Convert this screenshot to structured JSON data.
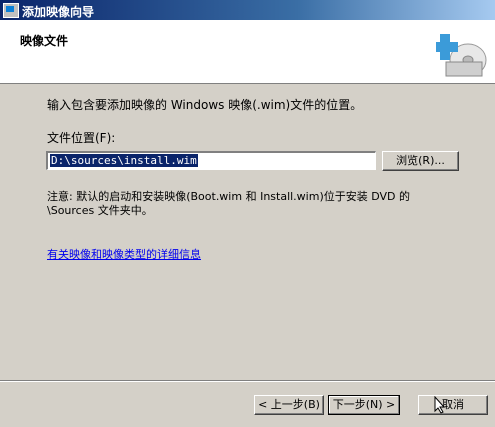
{
  "window": {
    "title": "添加映像向导"
  },
  "header": {
    "title": "映像文件",
    "icon": "add-disk-icon"
  },
  "main": {
    "instruction": "输入包含要添加映像的 Windows 映像(.wim)文件的位置。",
    "file_location_label": "文件位置(F):",
    "file_location_value": "D:\\sources\\install.wim",
    "browse_label": "浏览(R)...",
    "note": "注意: 默认的启动和安装映像(Boot.wim 和 Install.wim)位于安装 DVD 的 \\Sources 文件夹中。",
    "more_info_link": "有关映像和映像类型的详细信息"
  },
  "footer": {
    "back_label": "< 上一步(B)",
    "next_label": "下一步(N) >",
    "cancel_label": "取消"
  }
}
